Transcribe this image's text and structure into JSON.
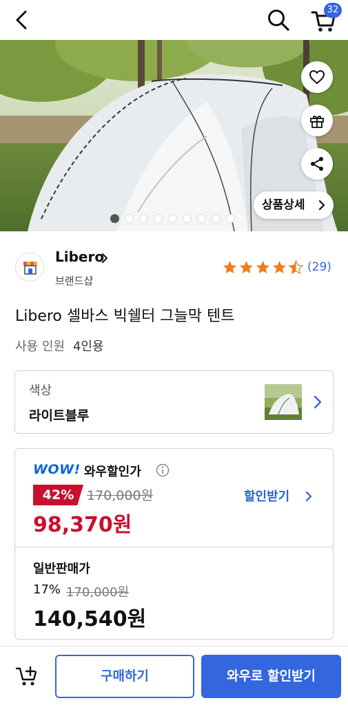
{
  "header": {
    "cart_count": "32",
    "icons": [
      "back-arrow-icon",
      "search-icon",
      "cart-icon"
    ]
  },
  "hero": {
    "image_alt": "tent photo",
    "detail_button_label": "상품상세",
    "total_images": 9,
    "active_image": 1,
    "icons": [
      "heart-icon",
      "gift-icon",
      "share-icon"
    ]
  },
  "brand": {
    "name": "Libero",
    "sub_label": "브랜드샵",
    "rating": 4.5,
    "rating_count": "(29)"
  },
  "product": {
    "title": "Libero 셀바스 빅쉘터 그늘막 텐트",
    "usage_label": "사용 인원",
    "usage_value": "4인용"
  },
  "option": {
    "label": "색상",
    "value": "라이트블루"
  },
  "price": {
    "wow_logo": "WOW!",
    "wow_label": "와우할인가",
    "discount_badge": "42%",
    "original_price": "170,000원",
    "wow_price": "98,370원",
    "coupon_link": "할인받기",
    "normal_label": "일반판매가",
    "normal_percent": "17%",
    "normal_original": "170,000원",
    "normal_price": "140,540원"
  },
  "bottom": {
    "buy_label": "구매하기",
    "wow_buy_label": "와우로 할인받기"
  },
  "colors": {
    "accent": "#3466e0",
    "discount_red": "#c8102e",
    "wow_blue": "#0d64d8",
    "star": "#f07d1a"
  }
}
